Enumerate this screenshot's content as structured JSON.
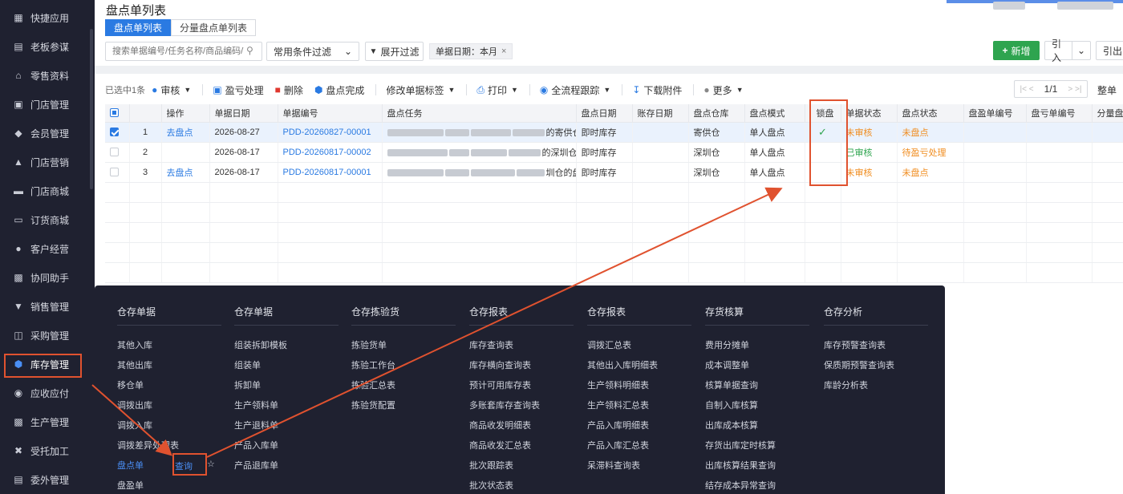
{
  "sidebar": {
    "items": [
      {
        "label": "快捷应用",
        "icon": "apps-icon"
      },
      {
        "label": "老板参谋",
        "icon": "report-icon"
      },
      {
        "label": "零售资料",
        "icon": "shop-icon"
      },
      {
        "label": "门店管理",
        "icon": "store-icon"
      },
      {
        "label": "会员管理",
        "icon": "diamond-icon"
      },
      {
        "label": "门店营销",
        "icon": "marketing-icon"
      },
      {
        "label": "门店商城",
        "icon": "mall-icon"
      },
      {
        "label": "订货商城",
        "icon": "order-mall-icon"
      },
      {
        "label": "客户经营",
        "icon": "customer-icon"
      },
      {
        "label": "协同助手",
        "icon": "assistant-icon"
      },
      {
        "label": "销售管理",
        "icon": "sales-icon"
      },
      {
        "label": "采购管理",
        "icon": "cart-icon"
      },
      {
        "label": "库存管理",
        "icon": "cube-icon"
      },
      {
        "label": "应收应付",
        "icon": "finance-icon"
      },
      {
        "label": "生产管理",
        "icon": "factory-icon"
      },
      {
        "label": "受托加工",
        "icon": "tools-icon"
      },
      {
        "label": "委外管理",
        "icon": "outsource-icon"
      }
    ],
    "active_index": 12
  },
  "page": {
    "title": "盘点单列表",
    "tabs": [
      "盘点单列表",
      "分量盘点单列表"
    ]
  },
  "filter": {
    "search_placeholder": "搜索单据编号/任务名称/商品编码/商品",
    "condition_select": "常用条件过滤",
    "expand_label": "展开过滤",
    "chip_label": "单据日期：本月",
    "chip_close": "×",
    "new_label": "新增",
    "import_label": "引入",
    "export_label": "引出"
  },
  "toolbar": {
    "selected_text": "已选中1条",
    "audit": "审核",
    "profit_loss": "盈亏处理",
    "delete": "删除",
    "complete": "盘点完成",
    "modify_tag": "修改单据标签",
    "print": "打印",
    "trace": "全流程跟踪",
    "download": "下载附件",
    "more": "更多",
    "pager": "1/1",
    "whole_label": "整单"
  },
  "table": {
    "columns": [
      "操作",
      "单据日期",
      "单据编号",
      "盘点任务",
      "盘点日期",
      "账存日期",
      "盘点仓库",
      "盘点模式",
      "锁盘",
      "单据状态",
      "盘点状态",
      "盘盈单编号",
      "盘亏单编号",
      "分量盘"
    ],
    "rows": [
      {
        "no": "1",
        "op": "去盘点",
        "date": "2026-08-27",
        "code": "PDD-20260827-00001",
        "task_suffix": "的寄供仓的盘点单",
        "count_date": "即时库存",
        "book_date": "",
        "warehouse": "寄供仓",
        "mode": "单人盘点",
        "lock": "✓",
        "doc_status": "未审核",
        "count_status": "未盘点",
        "selected": true
      },
      {
        "no": "2",
        "op": "",
        "date": "2026-08-17",
        "code": "PDD-20260817-00002",
        "task_suffix": "的深圳仓的盘点单",
        "count_date": "即时库存",
        "book_date": "",
        "warehouse": "深圳仓",
        "mode": "单人盘点",
        "lock": "",
        "doc_status": "已审核",
        "count_status": "待盈亏处理",
        "selected": false
      },
      {
        "no": "3",
        "op": "去盘点",
        "date": "2026-08-17",
        "code": "PDD-20260817-00001",
        "task_suffix": "圳仓的盘点单",
        "count_date": "即时库存",
        "book_date": "",
        "warehouse": "深圳仓",
        "mode": "单人盘点",
        "lock": "",
        "doc_status": "未审核",
        "count_status": "未盘点",
        "selected": false
      }
    ]
  },
  "mega_menu": {
    "columns": [
      {
        "title": "仓存单据",
        "items": [
          "其他入库",
          "其他出库",
          "移仓单",
          "调拨出库",
          "调拨入库",
          "调拨差异处理表",
          "盘点单",
          "盘盈单"
        ]
      },
      {
        "title": "仓存单据",
        "items": [
          "组装拆卸模板",
          "组装单",
          "拆卸单",
          "生产领料单",
          "生产退料单",
          "产品入库单",
          "产品退库单"
        ]
      },
      {
        "title": "仓存拣验货",
        "items": [
          "拣验货单",
          "拣验工作台",
          "拣验汇总表",
          "拣验货配置"
        ]
      },
      {
        "title": "仓存报表",
        "items": [
          "库存查询表",
          "库存横向查询表",
          "预计可用库存表",
          "多账套库存查询表",
          "商品收发明细表",
          "商品收发汇总表",
          "批次跟踪表",
          "批次状态表"
        ]
      },
      {
        "title": "仓存报表",
        "items": [
          "调拨汇总表",
          "其他出入库明细表",
          "生产领料明细表",
          "生产领料汇总表",
          "产品入库明细表",
          "产品入库汇总表",
          "呆滞料查询表"
        ]
      },
      {
        "title": "存货核算",
        "items": [
          "费用分摊单",
          "成本调整单",
          "核算单据查询",
          "自制入库核算",
          "出库成本核算",
          "存货出库定时核算",
          "出库核算结果查询",
          "结存成本异常查询"
        ]
      },
      {
        "title": "仓存分析",
        "items": [
          "库存预警查询表",
          "保质期预警查询表",
          "库龄分析表"
        ]
      }
    ],
    "query_label": "查询",
    "star": "☆"
  },
  "colors": {
    "sidebar_bg": "#1f2130",
    "primary": "#2a7ae2",
    "success": "#2ea44f",
    "warning": "#f08c1e",
    "annotation": "#e0522f"
  }
}
